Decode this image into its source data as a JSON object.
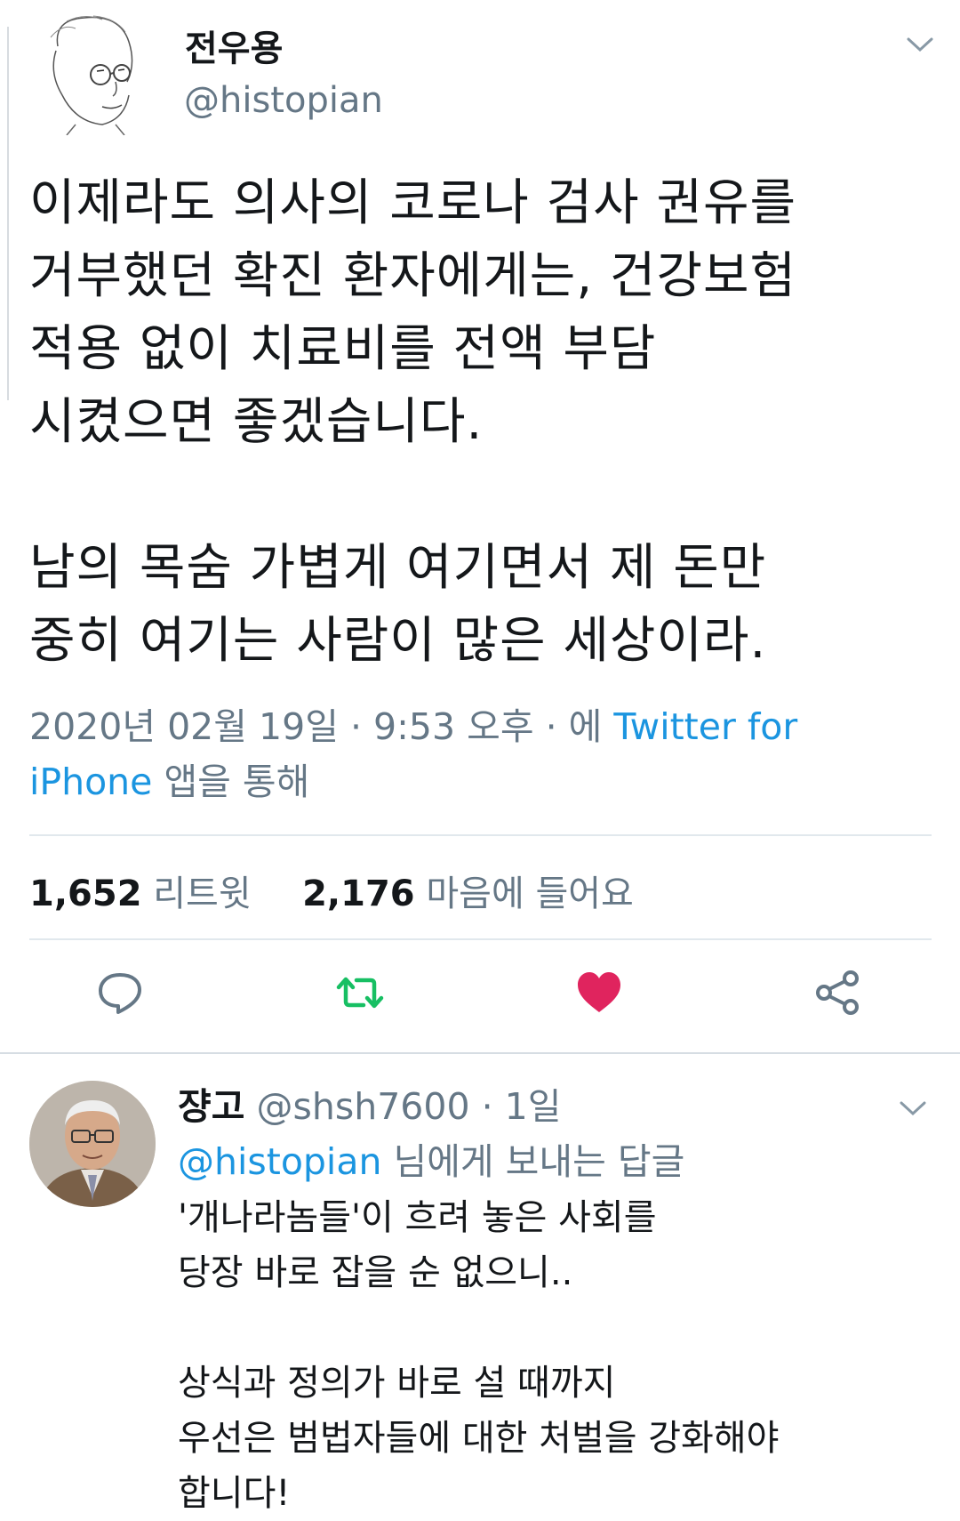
{
  "tweet": {
    "author_name": "전우용",
    "author_handle": "@histopian",
    "text": "이제라도 의사의 코로나 검사 권유를\n거부했던 확진 환자에게는, 건강보험\n적용 없이 치료비를 전액 부담\n시켰으면 좋겠습니다.\n\n남의 목숨 가볍게 여기면서 제 돈만\n중히 여기는 사람이 많은 세상이라.",
    "timestamp": "2020년 02월 19일 · 9:53 오후 · 에 ",
    "source": "Twitter for iPhone",
    "source_suffix": " 앱을 통해",
    "retweet_count": "1,652",
    "retweet_label": "리트윗",
    "like_count": "2,176",
    "like_label": "마음에 들어요",
    "icons": [
      "chevron-down-icon",
      "reply-icon",
      "retweet-icon",
      "heart-icon",
      "share-icon"
    ],
    "colors": {
      "retweet_active": "#17bf63",
      "like_active": "#e0245e",
      "link": "#1b95e0",
      "muted": "#657786"
    }
  },
  "reply": {
    "author_name": "쟝고",
    "author_handle": "@shsh7600",
    "time": " · 1일",
    "replying_to": "@histopian",
    "replying_suffix": " 님에게 보내는 답글",
    "text": "'개나라놈들'이 흐려 놓은 사회를\n당장 바로 잡을 순 없으니..\n\n상식과 정의가 바로 설 때까지\n우선은 범법자들에 대한 처벌을 강화해야\n합니다!"
  }
}
